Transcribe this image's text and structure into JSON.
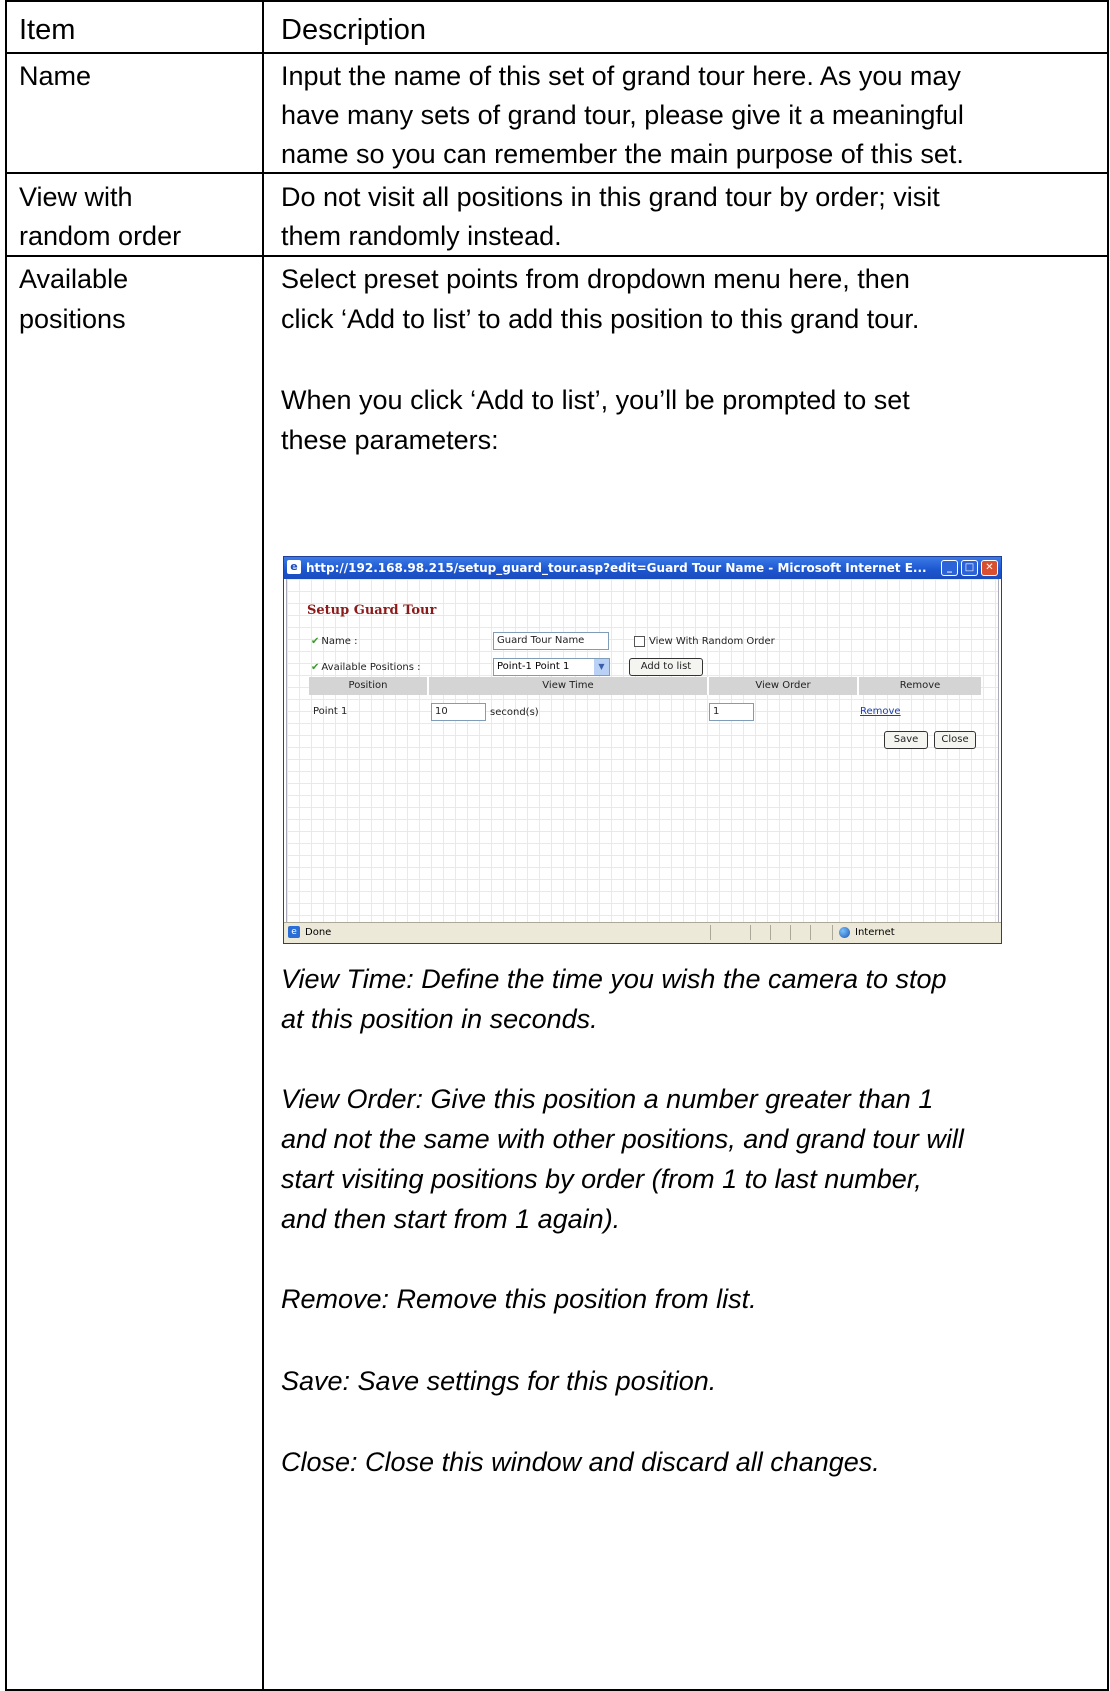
{
  "table": {
    "header": {
      "item": "Item",
      "description": "Description"
    },
    "rows": [
      {
        "item_lines": [
          "Name"
        ],
        "desc_lines": [
          "Input the name of this set of grand tour here. As you may",
          "have many sets of grand tour, please give it a meaningful",
          "name so you can remember the main purpose of this set."
        ]
      },
      {
        "item_lines": [
          "View with",
          "random order"
        ],
        "desc_lines": [
          "Do not visit all positions in this grand tour by order; visit",
          "them randomly instead."
        ]
      },
      {
        "item_lines": [
          "Available",
          "positions"
        ],
        "desc_lines": [
          "Select preset points from dropdown menu here, then",
          "click ‘Add to list’ to add this position to this grand tour."
        ],
        "prompt_lines": [
          "When you click ‘Add to list’, you’ll be prompted to set",
          "these parameters:"
        ],
        "notes": {
          "view_time": [
            "View Time: Define the time you wish the camera to stop",
            "at this position in seconds."
          ],
          "view_order": [
            "View Order: Give this position a number greater than 1",
            "and not the same with other positions, and grand tour will",
            "start visiting positions by order (from 1 to last number,",
            "and then start from 1 again)."
          ],
          "remove": "Remove: Remove this position from list.",
          "save": "Save: Save settings for this position.",
          "close": "Close: Close this window and discard all changes."
        }
      }
    ]
  },
  "screenshot": {
    "window_title": "http://192.168.98.215/setup_guard_tour.asp?edit=Guard Tour Name - Microsoft Internet E...",
    "form_title": "Setup Guard Tour",
    "name_label": "Name :",
    "name_value": "Guard Tour Name",
    "random_label": "View With Random Order",
    "positions_label": "Available Positions :",
    "positions_selected": "Point-1  Point 1",
    "add_button": "Add to list",
    "columns": [
      "Position",
      "View Time",
      "View Order",
      "Remove"
    ],
    "row": {
      "position": "Point 1",
      "view_time": "10",
      "unit": "second(s)",
      "view_order": "1",
      "remove_link": "Remove"
    },
    "save_button": "Save",
    "close_button": "Close",
    "status_left": "Done",
    "status_right": "Internet"
  }
}
